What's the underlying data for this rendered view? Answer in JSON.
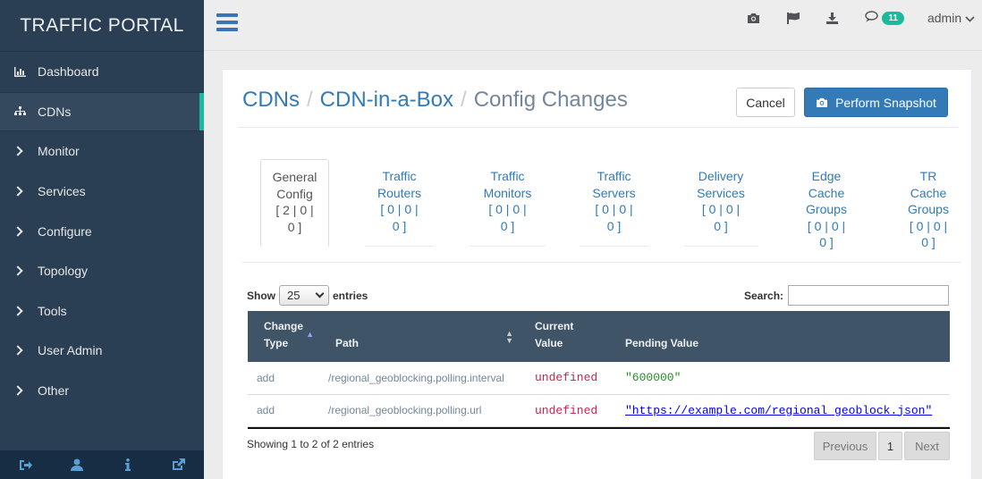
{
  "app": {
    "title": "TRAFFIC PORTAL"
  },
  "sidebar": {
    "items": [
      {
        "label": "Dashboard",
        "icon": "bar-chart-icon"
      },
      {
        "label": "CDNs",
        "icon": "sitemap-icon"
      },
      {
        "label": "Monitor",
        "icon": "chevron-right-icon"
      },
      {
        "label": "Services",
        "icon": "chevron-right-icon"
      },
      {
        "label": "Configure",
        "icon": "chevron-right-icon"
      },
      {
        "label": "Topology",
        "icon": "chevron-right-icon"
      },
      {
        "label": "Tools",
        "icon": "chevron-right-icon"
      },
      {
        "label": "User Admin",
        "icon": "chevron-right-icon"
      },
      {
        "label": "Other",
        "icon": "chevron-right-icon"
      }
    ],
    "active": "CDNs",
    "footer_icons": [
      "logout-icon",
      "user-icon",
      "info-icon",
      "external-link-icon"
    ]
  },
  "topbar": {
    "icons": [
      "camera-icon",
      "flag-icon",
      "download-icon",
      "comment-icon"
    ],
    "notification_count": "11",
    "user": "admin"
  },
  "page": {
    "breadcrumb": [
      "CDNs",
      "CDN-in-a-Box",
      "Config Changes"
    ],
    "cancel_label": "Cancel",
    "snapshot_label": "Perform Snapshot"
  },
  "tabs": [
    {
      "label": "General Config",
      "counts": "[ 2 | 0 | 0 ]",
      "active": true
    },
    {
      "label": "Traffic Routers",
      "counts": "[ 0 | 0 | 0 ]"
    },
    {
      "label": "Traffic Monitors",
      "counts": "[ 0 | 0 | 0 ]"
    },
    {
      "label": "Traffic Servers",
      "counts": "[ 0 | 0 | 0 ]"
    },
    {
      "label": "Delivery Services",
      "counts": "[ 0 | 0 | 0 ]"
    },
    {
      "label": "Edge Cache Groups",
      "counts": "[ 0 | 0 | 0 ]"
    },
    {
      "label": "TR Cache Groups",
      "counts": "[ 0 | 0 | 0 ]"
    }
  ],
  "table": {
    "show_label": "Show",
    "entries_label": "entries",
    "page_size": "25",
    "search_label": "Search:",
    "search_value": "",
    "headers": [
      "Change Type",
      "Path",
      "Current Value",
      "Pending Value"
    ],
    "rows": [
      {
        "change_type": "add",
        "path": "/regional_geoblocking.polling.interval",
        "current": "undefined",
        "pending": "\"600000\""
      },
      {
        "change_type": "add",
        "path": "/regional_geoblocking.polling.url",
        "current": "undefined",
        "pending": "\"https://example.com/regional_geoblock.json\""
      }
    ],
    "info": "Showing 1 to 2 of 2 entries",
    "pagination": {
      "previous": "Previous",
      "page": "1",
      "next": "Next"
    }
  }
}
